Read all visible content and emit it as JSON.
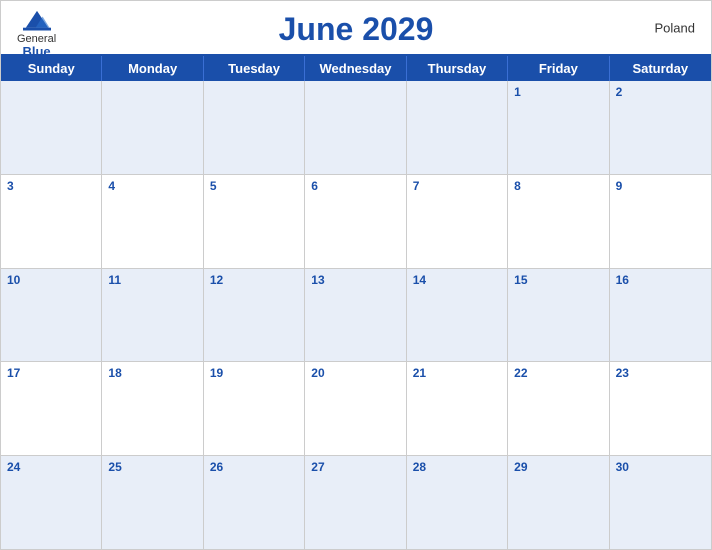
{
  "header": {
    "title": "June 2029",
    "country": "Poland",
    "logo": {
      "general": "General",
      "blue": "Blue"
    }
  },
  "dayHeaders": [
    "Sunday",
    "Monday",
    "Tuesday",
    "Wednesday",
    "Thursday",
    "Friday",
    "Saturday"
  ],
  "weeks": [
    [
      {
        "day": "",
        "empty": true
      },
      {
        "day": "",
        "empty": true
      },
      {
        "day": "",
        "empty": true
      },
      {
        "day": "",
        "empty": true
      },
      {
        "day": "",
        "empty": true
      },
      {
        "day": "1",
        "empty": false
      },
      {
        "day": "2",
        "empty": false
      }
    ],
    [
      {
        "day": "3",
        "empty": false
      },
      {
        "day": "4",
        "empty": false
      },
      {
        "day": "5",
        "empty": false
      },
      {
        "day": "6",
        "empty": false
      },
      {
        "day": "7",
        "empty": false
      },
      {
        "day": "8",
        "empty": false
      },
      {
        "day": "9",
        "empty": false
      }
    ],
    [
      {
        "day": "10",
        "empty": false
      },
      {
        "day": "11",
        "empty": false
      },
      {
        "day": "12",
        "empty": false
      },
      {
        "day": "13",
        "empty": false
      },
      {
        "day": "14",
        "empty": false
      },
      {
        "day": "15",
        "empty": false
      },
      {
        "day": "16",
        "empty": false
      }
    ],
    [
      {
        "day": "17",
        "empty": false
      },
      {
        "day": "18",
        "empty": false
      },
      {
        "day": "19",
        "empty": false
      },
      {
        "day": "20",
        "empty": false
      },
      {
        "day": "21",
        "empty": false
      },
      {
        "day": "22",
        "empty": false
      },
      {
        "day": "23",
        "empty": false
      }
    ],
    [
      {
        "day": "24",
        "empty": false
      },
      {
        "day": "25",
        "empty": false
      },
      {
        "day": "26",
        "empty": false
      },
      {
        "day": "27",
        "empty": false
      },
      {
        "day": "28",
        "empty": false
      },
      {
        "day": "29",
        "empty": false
      },
      {
        "day": "30",
        "empty": false
      }
    ]
  ]
}
